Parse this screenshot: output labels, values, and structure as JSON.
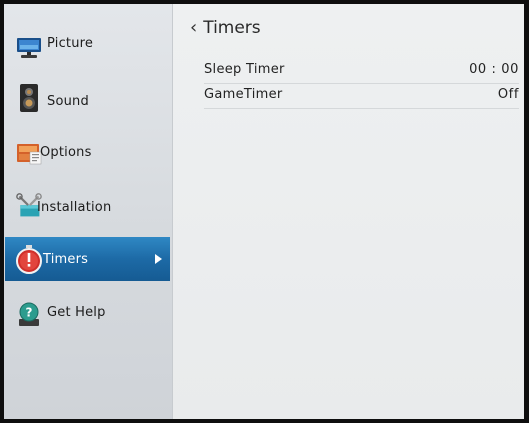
{
  "sidebar": {
    "items": [
      {
        "label": "Picture",
        "icon": "picture-icon"
      },
      {
        "label": "Sound",
        "icon": "sound-icon"
      },
      {
        "label": "Options",
        "icon": "options-icon"
      },
      {
        "label": "Installation",
        "icon": "installation-icon"
      },
      {
        "label": "Timers",
        "icon": "timer-icon",
        "selected": true
      },
      {
        "label": "Get Help",
        "icon": "help-icon"
      }
    ]
  },
  "header": {
    "title": "Timers"
  },
  "settings": [
    {
      "label": "Sleep Timer",
      "value": "00 : 00"
    },
    {
      "label": "GameTimer",
      "value": "Off"
    }
  ],
  "colors": {
    "accent": "#1f73b0",
    "sidebar_bg": "#d9dde1",
    "main_bg": "#ececec",
    "frame": "#0e0e0e"
  }
}
